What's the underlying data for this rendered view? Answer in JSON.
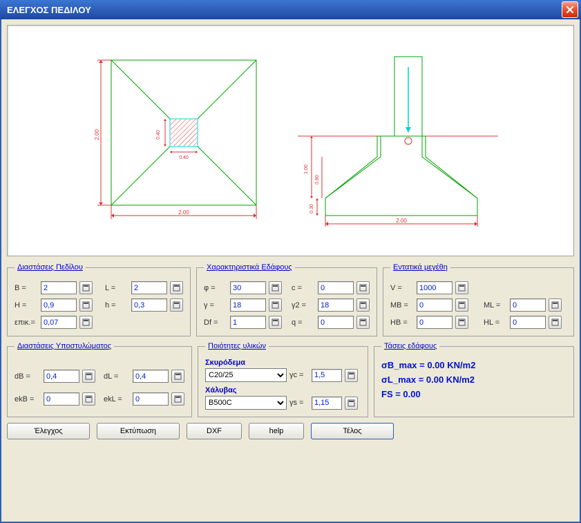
{
  "window": {
    "title": "ΕΛΕΓΧΟΣ ΠΕΔΙΛΟΥ"
  },
  "groups": {
    "footing_dims": "Διαστάσεις Πεδίλου",
    "soil_props": "Χαρακτηριστικά Εδάφους",
    "loads": "Εντατικά μεγέθη",
    "column_dims": "Διαστάσεις Υποστυλώματος",
    "material_quality": "Ποιότητες υλικών",
    "soil_stress": "Τάσεις εδάφους"
  },
  "labels": {
    "B": "B =",
    "L": "L =",
    "H": "H =",
    "h": "h =",
    "epik": "επικ.=",
    "phi": "φ =",
    "c": "c =",
    "g": "γ =",
    "g2": "γ2 =",
    "Df": "Df =",
    "q": "q =",
    "V": "V =",
    "MB": "MB =",
    "ML": "ML =",
    "HB": "HB =",
    "HL": "HL =",
    "dB": "dB =",
    "dL": "dL =",
    "ekB": "ekB =",
    "ekL": "ekL =",
    "concrete": "Σκυρόδεμα",
    "steel": "Χάλυβας",
    "gc": "γc =",
    "gs": "γs ="
  },
  "values": {
    "B": "2",
    "L": "2",
    "H": "0,9",
    "h": "0,3",
    "epik": "0,07",
    "phi": "30",
    "c": "0",
    "g": "18",
    "g2": "18",
    "Df": "1",
    "q": "0",
    "V": "1000",
    "MB": "0",
    "ML": "0",
    "HB": "0",
    "HL": "0",
    "dB": "0,4",
    "dL": "0,4",
    "ekB": "0",
    "ekL": "0",
    "concrete": "C20/25",
    "steel": "B500C",
    "gc": "1,5",
    "gs": "1,15"
  },
  "stresses": {
    "sB": "σB_max = 0.00 KN/m2",
    "sL": "σL_max = 0.00 KN/m2",
    "FS": "FS  = 0.00"
  },
  "buttons": {
    "check": "Έλεγχος",
    "print": "Εκτύπωση",
    "dxf": "DXF",
    "help": "help",
    "close": "Τέλος"
  },
  "diagram": {
    "plan_W": "2.00",
    "plan_H": "2.00",
    "col_b": "0.40",
    "col_h": "0.40",
    "sect_W": "2.00",
    "sect_H1": "1.00",
    "sect_t": "0.30",
    "sect_g": "0.80"
  }
}
